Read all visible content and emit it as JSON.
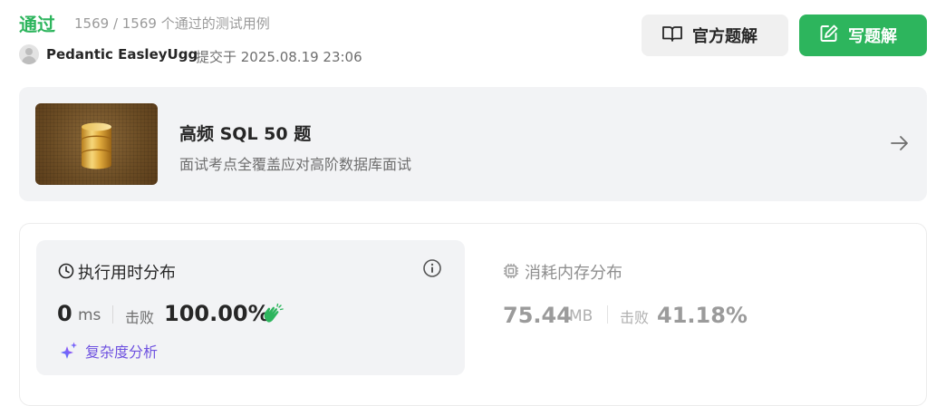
{
  "header": {
    "status": "通过",
    "tests": "1569 / 1569 个通过的测试用例",
    "user": "Pedantic EasleyUgg",
    "submitted": "提交于 2025.08.19 23:06",
    "official_solution": "官方题解",
    "write_solution": "写题解"
  },
  "banner": {
    "title": "高频 SQL 50 题",
    "subtitle": "面试考点全覆盖应对高阶数据库面试"
  },
  "runtime": {
    "title": "执行用时分布",
    "value": "0",
    "unit": "ms",
    "beat_label": "击败",
    "beat_value": "100.00%",
    "complexity_link": "复杂度分析"
  },
  "memory": {
    "title": "消耗内存分布",
    "value": "75.44",
    "unit": "MB",
    "beat_label": "击败",
    "beat_value": "41.18%"
  },
  "colors": {
    "accent_green": "#2db55d",
    "complexity_purple": "#6f52e0"
  }
}
